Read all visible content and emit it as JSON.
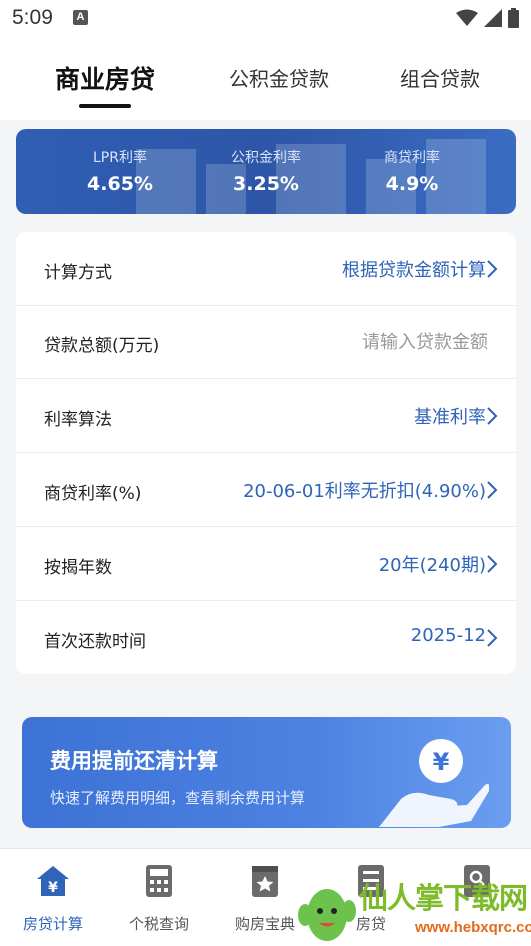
{
  "status_bar": {
    "time": "5:09",
    "badge": "A"
  },
  "tabs": [
    {
      "label": "商业房贷",
      "active": true
    },
    {
      "label": "公积金贷款",
      "active": false
    },
    {
      "label": "组合贷款",
      "active": false
    }
  ],
  "rates": [
    {
      "label": "LPR利率",
      "value": "4.65%"
    },
    {
      "label": "公积金利率",
      "value": "3.25%"
    },
    {
      "label": "商贷利率",
      "value": "4.9%"
    }
  ],
  "form": {
    "rows": [
      {
        "label": "计算方式",
        "value": "根据贷款金额计算"
      },
      {
        "label": "贷款总额(万元)",
        "placeholder": "请输入贷款金额",
        "value": ""
      },
      {
        "label": "利率算法",
        "value": "基准利率"
      },
      {
        "label": "商贷利率(%)",
        "value": "20-06-01利率无折扣(4.90%)"
      },
      {
        "label": "按揭年数",
        "value": "20年(240期)"
      },
      {
        "label": "首次还款时间",
        "value": "2025-12"
      }
    ]
  },
  "promo": {
    "title": "费用提前还清计算",
    "subtitle": "快速了解费用明细，查看剩余费用计算",
    "icon_symbol": "¥"
  },
  "bottom_nav": [
    {
      "label": "房贷计算",
      "icon": "house-yen-icon",
      "active": true
    },
    {
      "label": "个税查询",
      "icon": "calculator-icon",
      "active": false
    },
    {
      "label": "购房宝典",
      "icon": "book-star-icon",
      "active": false
    },
    {
      "label": "房贷",
      "icon": "checklist-icon",
      "active": false
    },
    {
      "label": "",
      "icon": "search-doc-icon",
      "active": false
    }
  ],
  "watermark": {
    "text": "仙人掌下载网",
    "url": "www.hebxqrc.com"
  },
  "colors": {
    "accent": "#2f64b8",
    "banner": "#2f5eb4",
    "promo": "#4d82e2"
  }
}
